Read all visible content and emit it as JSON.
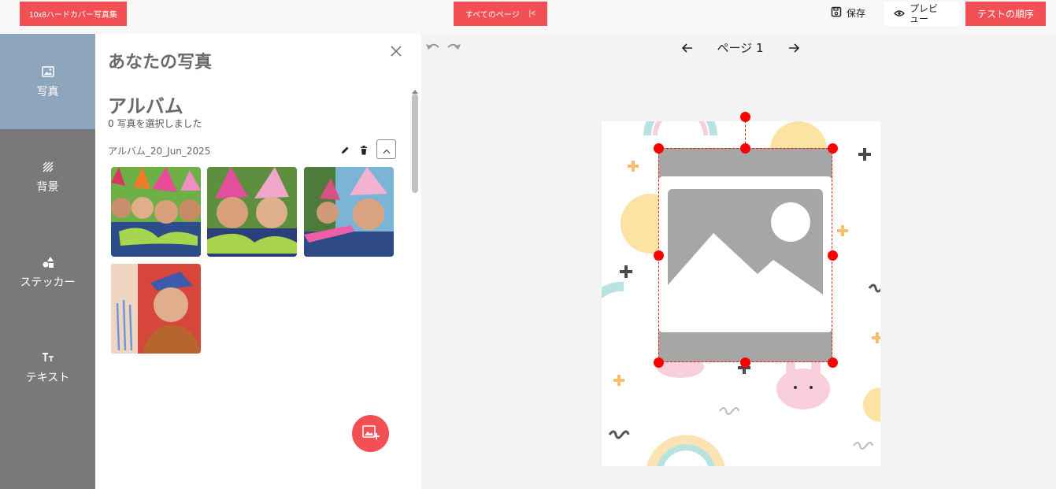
{
  "header": {
    "product_label": "10x8ハードカバー写真集",
    "all_pages_label": "すべてのページ",
    "collapse_glyph": "|<",
    "save_label": "保存",
    "preview_label": "プレビュー",
    "order_label": "テストの順序",
    "accent_color": "#f25054"
  },
  "sidebar": {
    "items": [
      {
        "label": "写真",
        "icon": "image-icon",
        "active": true
      },
      {
        "label": "背景",
        "icon": "hatch-icon",
        "active": false
      },
      {
        "label": "ステッカー",
        "icon": "shapes-icon",
        "active": false
      },
      {
        "label": "テキスト",
        "icon": "text-icon",
        "active": false
      }
    ],
    "active_color": "#8ea6bc",
    "bg_color": "#797979"
  },
  "photos_panel": {
    "title": "あなたの写真",
    "album_heading": "アルバム",
    "selected_text": "0 写真を選択しました",
    "album_name": "アルバム_20_Jun_2025",
    "photos": [
      {
        "desc": "four children in party hats"
      },
      {
        "desc": "two children in party hats"
      },
      {
        "desc": "children blowing party horns"
      },
      {
        "desc": "boy blowing birthday candles"
      }
    ]
  },
  "editor": {
    "page_label": "ページ 1",
    "placeholder": "image-placeholder-icon",
    "selection_color": "#ff0000"
  }
}
